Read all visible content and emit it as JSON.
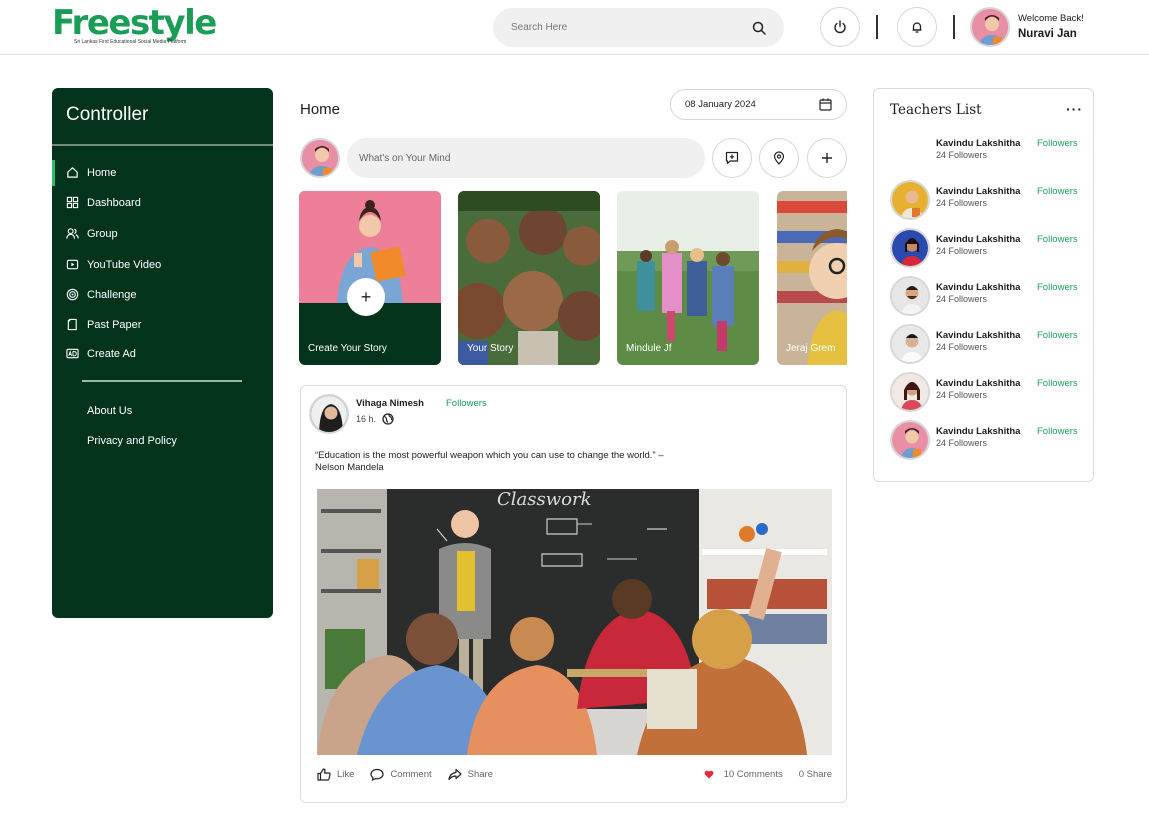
{
  "brand": {
    "name": "Freestyle",
    "tagline": "Sri Lankas First Educational Social Media Platform",
    "accent": "#1a9d55",
    "sidebar_bg": "#04331c"
  },
  "header": {
    "search_placeholder": "Search Here",
    "welcome": "Welcome Back!",
    "username": "Nuravi Jan"
  },
  "sidebar": {
    "title": "Controller",
    "items": [
      {
        "label": "Home",
        "icon": "home-icon"
      },
      {
        "label": "Dashboard",
        "icon": "dashboard-icon"
      },
      {
        "label": "Group",
        "icon": "group-icon"
      },
      {
        "label": "YouTube Video",
        "icon": "video-icon"
      },
      {
        "label": "Challenge",
        "icon": "target-icon"
      },
      {
        "label": "Past Paper",
        "icon": "paper-icon"
      },
      {
        "label": "Create Ad",
        "icon": "ad-icon"
      }
    ],
    "secondary": [
      {
        "label": "About Us"
      },
      {
        "label": "Privacy and Policy"
      }
    ]
  },
  "main": {
    "title": "Home",
    "date": "08 January 2024",
    "compose_placeholder": "What's on Your Mind",
    "stories": [
      {
        "label": "Create Your Story"
      },
      {
        "label": "Your Story"
      },
      {
        "label": "Mindule Jf"
      },
      {
        "label": "Jeraj Grem"
      }
    ]
  },
  "post": {
    "author": "Vihaga Nimesh",
    "follow": "Followers",
    "time": "16 h.",
    "text": "“Education is the most powerful weapon which you can use to change the world.” – Nelson Mandela",
    "board_text": "Classwork",
    "like": "Like",
    "comment": "Comment",
    "share": "Share",
    "comments_count": "10 Comments",
    "share_count": "0 Share"
  },
  "teachers": {
    "title": "Teachers  List",
    "more": "···",
    "list": [
      {
        "name": "Kavindu Lakshitha",
        "count": "24 Followers",
        "follow": "Followers"
      },
      {
        "name": "Kavindu Lakshitha",
        "count": "24 Followers",
        "follow": "Followers"
      },
      {
        "name": "Kavindu Lakshitha",
        "count": "24 Followers",
        "follow": "Followers"
      },
      {
        "name": "Kavindu Lakshitha",
        "count": "24 Followers",
        "follow": "Followers"
      },
      {
        "name": "Kavindu Lakshitha",
        "count": "24 Followers",
        "follow": "Followers"
      },
      {
        "name": "Kavindu Lakshitha",
        "count": "24 Followers",
        "follow": "Followers"
      },
      {
        "name": "Kavindu Lakshitha",
        "count": "24 Followers",
        "follow": "Followers"
      }
    ]
  }
}
